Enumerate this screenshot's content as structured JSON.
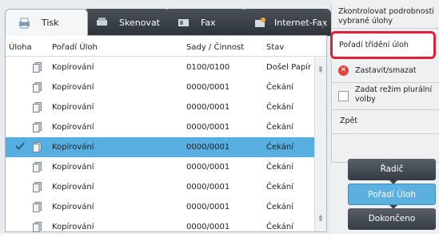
{
  "tabs": [
    {
      "label": "Tisk",
      "icon": "print-icon",
      "active": true
    },
    {
      "label": "Skenovat",
      "icon": "scan-icon",
      "active": false
    },
    {
      "label": "Fax",
      "icon": "fax-icon",
      "active": false
    },
    {
      "label": "Internet-Fax",
      "icon": "internet-fax-icon",
      "active": false
    }
  ],
  "table": {
    "headers": {
      "job": "Úloha",
      "order": "Pořadí Úloh",
      "sets": "Sady / Činnost",
      "status": "Stav"
    },
    "rows": [
      {
        "name": "Kopírování",
        "sets": "0100/0100",
        "status": "Došel Papír",
        "selected": false
      },
      {
        "name": "Kopírování",
        "sets": "0000/0001",
        "status": "Čekání",
        "selected": false
      },
      {
        "name": "Kopírování",
        "sets": "0000/0001",
        "status": "Čekání",
        "selected": false
      },
      {
        "name": "Kopírování",
        "sets": "0000/0001",
        "status": "Čekání",
        "selected": false
      },
      {
        "name": "Kopírování",
        "sets": "0000/0001",
        "status": "Čekání",
        "selected": true
      },
      {
        "name": "Kopírování",
        "sets": "0000/0001",
        "status": "Čekání",
        "selected": false
      },
      {
        "name": "Kopírování",
        "sets": "0000/0001",
        "status": "Čekání",
        "selected": false
      },
      {
        "name": "Kopírování",
        "sets": "0000/0001",
        "status": "Čekání",
        "selected": false
      },
      {
        "name": "Kopírování",
        "sets": "0000/0001",
        "status": "Čekání",
        "selected": false
      }
    ]
  },
  "menu": {
    "check_details": "Zkontrolovat podrobnosti vybrané úlohy",
    "sort_jobs": "Pořadí třídění úloh",
    "stop_delete": "Zastavit/smazat",
    "plural_mode": "Zadat režim plurální volby",
    "back": "Zpět"
  },
  "buttons": {
    "spooler": "Řadič",
    "job_queue": "Pořadí Úloh",
    "complete": "Dokončeno"
  },
  "colors": {
    "highlight": "#e11f3a",
    "selection": "#57aee0",
    "active_button": "#5cb0e0"
  }
}
